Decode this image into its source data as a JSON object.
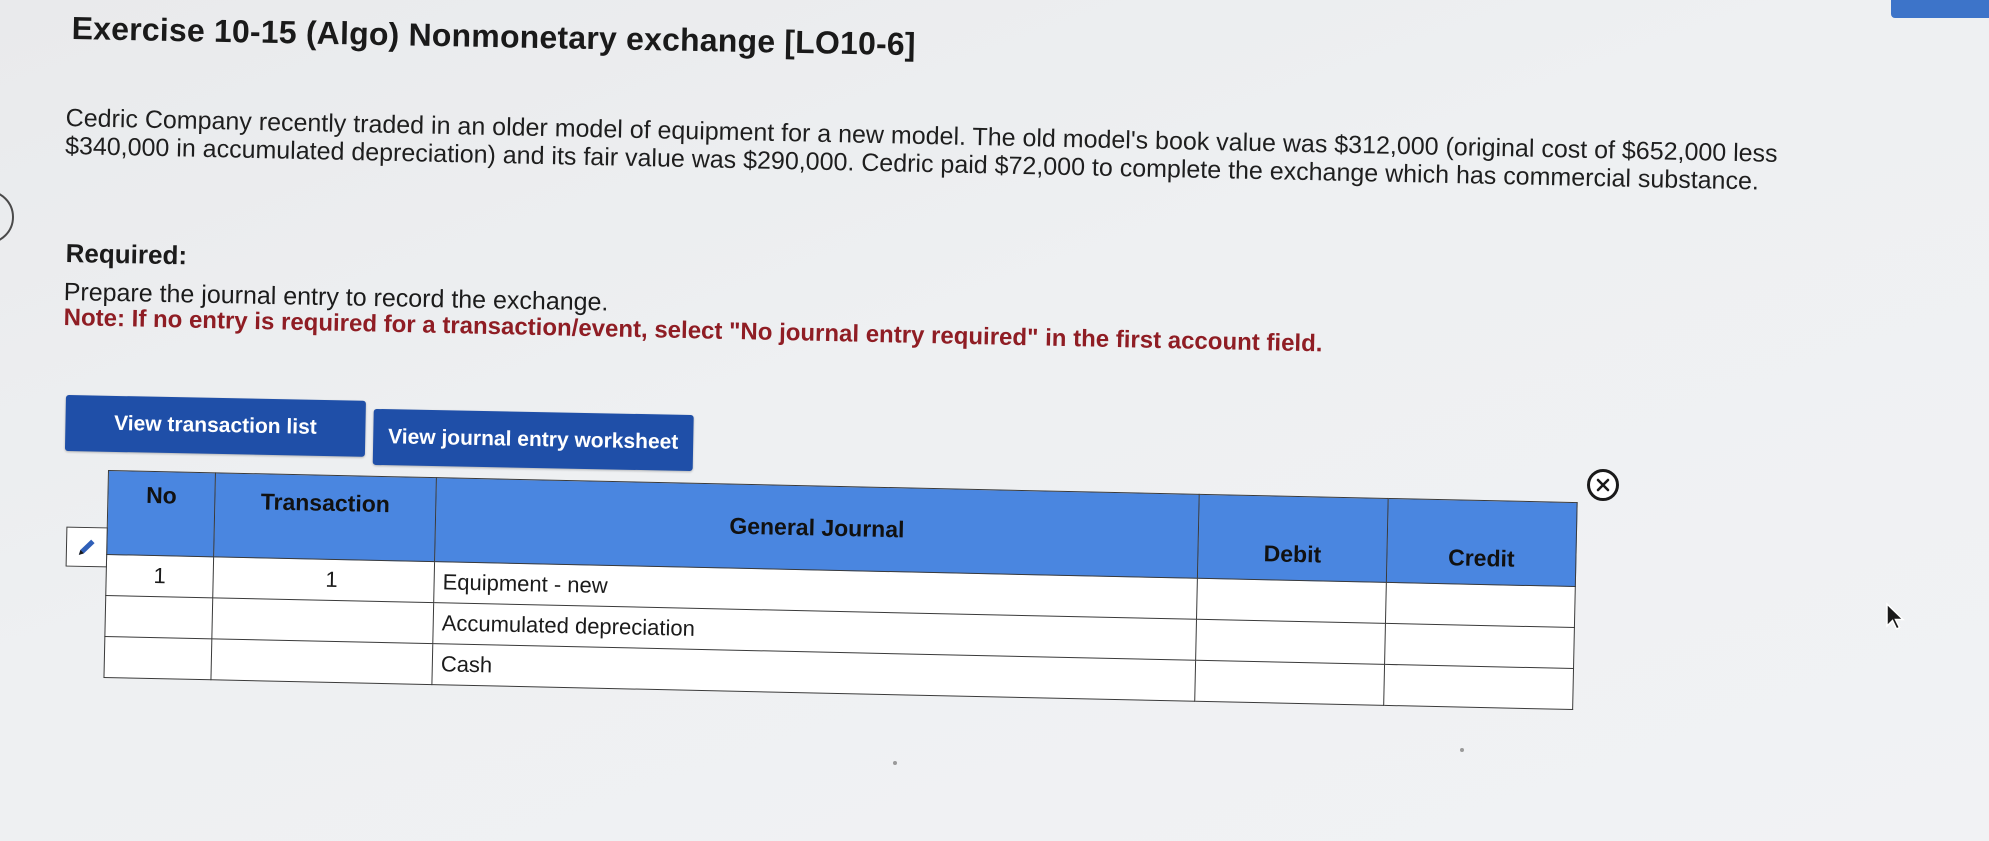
{
  "exercise": {
    "title": "Exercise 10-15 (Algo) Nonmonetary exchange [LO10-6]",
    "problem_text": "Cedric Company recently traded in an older model of equipment for a new model. The old model's book value was $312,000 (original cost of $652,000 less $340,000 in accumulated depreciation) and its fair value was $290,000. Cedric paid $72,000 to complete the exchange which has commercial substance.",
    "required_heading": "Required:",
    "instruction": "Prepare the journal entry to record the exchange.",
    "note": "Note: If no entry is required for a transaction/event, select \"No journal entry required\" in the first account field."
  },
  "buttons": {
    "view_transaction_list": "View transaction list",
    "view_journal_entry_worksheet": "View journal entry worksheet"
  },
  "journal_table": {
    "headers": {
      "no": "No",
      "transaction": "Transaction",
      "general_journal": "General Journal",
      "debit": "Debit",
      "credit": "Credit"
    },
    "rows": [
      {
        "no": "1",
        "transaction": "1",
        "account": "Equipment - new",
        "debit": "",
        "credit": ""
      },
      {
        "no": "",
        "transaction": "",
        "account": "Accumulated depreciation",
        "debit": "",
        "credit": ""
      },
      {
        "no": "",
        "transaction": "",
        "account": "Cash",
        "debit": "",
        "credit": ""
      }
    ]
  },
  "icons": {
    "edit": "pencil-icon",
    "close": "close-circle-icon",
    "cursor": "mouse-cursor-icon"
  },
  "colors": {
    "button_bg": "#1f4fa8",
    "header_bg": "#4a86e0",
    "note_text": "#8f1d24"
  }
}
